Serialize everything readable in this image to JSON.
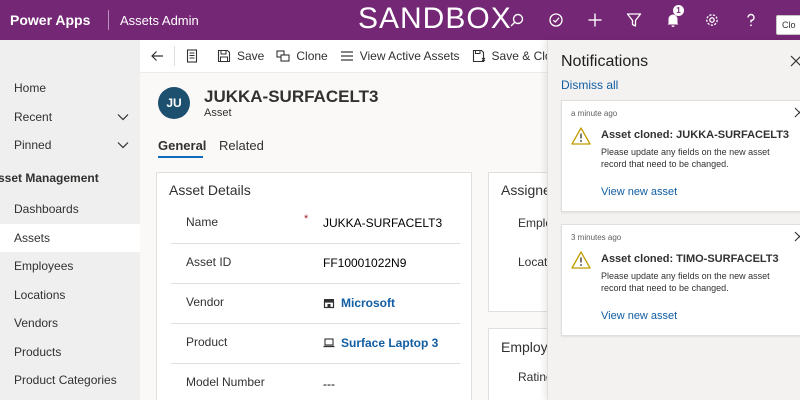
{
  "topbar": {
    "brand": "Power Apps",
    "app_name": "Assets Admin",
    "environment": "SANDBOX",
    "notification_count": "1",
    "tooltip": "Clo",
    "icons": [
      "search-icon",
      "target-icon",
      "plus-icon",
      "filter-icon",
      "bell-icon",
      "gear-icon",
      "help-icon"
    ]
  },
  "nav": {
    "items": [
      {
        "label": "Home"
      },
      {
        "label": "Recent"
      },
      {
        "label": "Pinned"
      }
    ],
    "section": "sset Management",
    "section_items": [
      {
        "label": "Dashboards"
      },
      {
        "label": "Assets"
      },
      {
        "label": "Employees"
      },
      {
        "label": "Locations"
      },
      {
        "label": "Vendors"
      },
      {
        "label": "Products"
      },
      {
        "label": "Product Categories"
      }
    ]
  },
  "commands": {
    "save": "Save",
    "clone": "Clone",
    "view_active": "View Active Assets",
    "save_close": "Save & Clo"
  },
  "record": {
    "initials": "JU",
    "title": "JUKKA-SURFACELT3",
    "entity": "Asset",
    "tabs": [
      "General",
      "Related"
    ]
  },
  "asset_details": {
    "title": "Asset Details",
    "required_marker": "*",
    "fields": [
      {
        "label": "Name",
        "value": "JUKKA-SURFACELT3"
      },
      {
        "label": "Asset ID",
        "value": "FF10001022N9"
      },
      {
        "label": "Vendor",
        "value": "Microsoft"
      },
      {
        "label": "Product",
        "value": "Surface Laptop 3"
      },
      {
        "label": "Model Number",
        "value": "---"
      }
    ]
  },
  "assignment": {
    "title": "Assigne",
    "labels": [
      "Emplo",
      "Locati"
    ]
  },
  "employee": {
    "title": "Employ",
    "labels": [
      "Rating"
    ]
  },
  "notifications": {
    "title": "Notifications",
    "dismiss_all": "Dismiss all",
    "items": [
      {
        "time": "a minute ago",
        "heading": "Asset cloned: JUKKA-SURFACELT3",
        "body": "Please update any fields on the new asset record that need to be changed.",
        "link": "View new asset"
      },
      {
        "time": "3 minutes ago",
        "heading": "Asset cloned: TIMO-SURFACELT3",
        "body": "Please update any fields on the new asset record that need to be changed.",
        "link": "View new asset"
      }
    ]
  },
  "colors": {
    "header": "#742774",
    "link": "#115ea3",
    "avatar": "#1d4f6e",
    "warning": "#c19c00"
  }
}
